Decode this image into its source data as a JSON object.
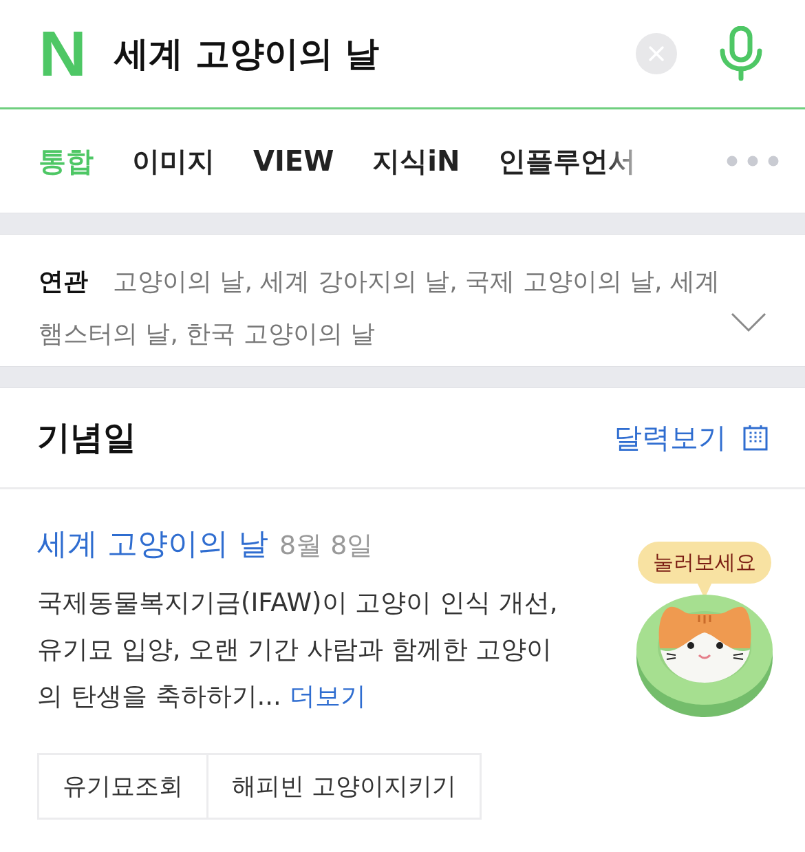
{
  "search": {
    "logo": "N",
    "query": "세계 고양이의 날"
  },
  "tabs": [
    {
      "label": "통합",
      "selected": true
    },
    {
      "label": "이미지",
      "selected": false
    },
    {
      "label": "VIEW",
      "selected": false
    },
    {
      "label": "지식iN",
      "selected": false
    },
    {
      "label": "인플루언서",
      "selected": false
    }
  ],
  "related": {
    "label": "연관",
    "text": "고양이의 날, 세계 강아지의 날, 국제 고양이의 날, 세계 햄스터의 날, 한국 고양이의 날",
    "expanded": false
  },
  "section": {
    "title": "기념일",
    "calendar_link": "달력보기"
  },
  "event": {
    "title": "세계 고양이의 날",
    "date": "8월 8일",
    "description": "국제동물복지기금(IFAW)이 고양이 인식 개선, 유기묘 입양, 오랜 기간 사람과 함께한 고양이의 탄생을 축하하기...",
    "more": "더보기",
    "bubble": "눌러보세요"
  },
  "buttons": [
    "유기묘조회",
    "해피빈 고양이지키기"
  ]
}
